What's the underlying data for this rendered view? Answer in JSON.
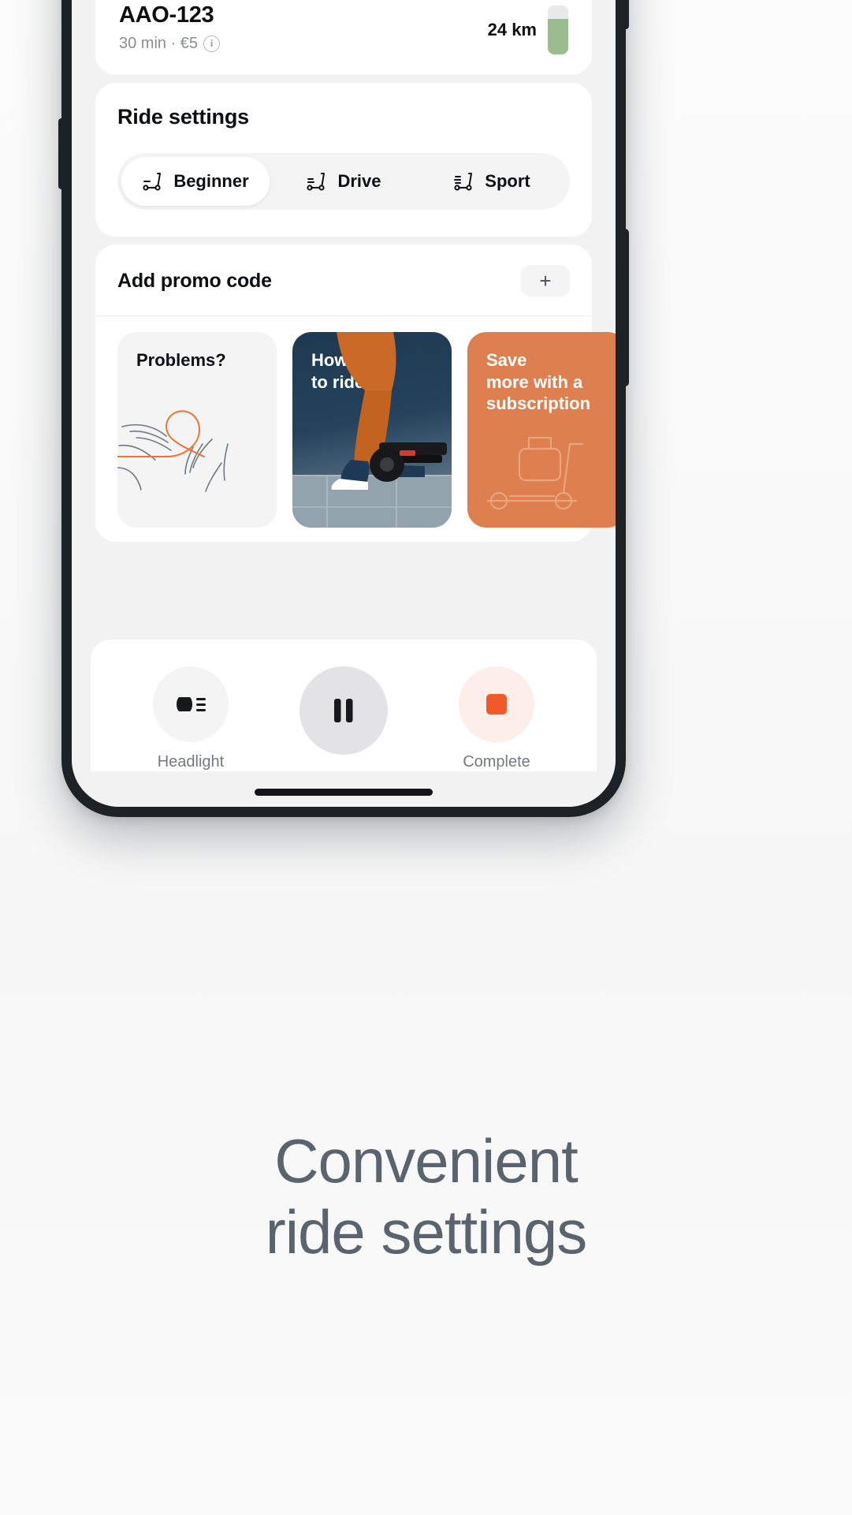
{
  "vehicle": {
    "id": "AAO-123",
    "pricing": "30 min · €5",
    "info_icon": "info-icon",
    "range": "24 km",
    "battery_icon": "battery-icon",
    "battery_level_pct": 72,
    "battery_color": "#9cbd8f"
  },
  "ride_settings": {
    "title": "Ride settings",
    "selected": "Beginner",
    "modes": [
      {
        "label": "Beginner",
        "icon": "scooter-icon",
        "active": true
      },
      {
        "label": "Drive",
        "icon": "scooter-icon",
        "active": false
      },
      {
        "label": "Sport",
        "icon": "scooter-icon",
        "active": false
      }
    ]
  },
  "promo": {
    "label": "Add promo code",
    "add_icon": "plus-icon",
    "add_label": "+"
  },
  "tiles": [
    {
      "title": "Problems?",
      "style": "light",
      "art": "hands-line-art"
    },
    {
      "title": "How\nto ride?",
      "title_line1": "How",
      "title_line2": "to ride?",
      "style": "photo",
      "art": "rider-photo"
    },
    {
      "title_line1": "Save",
      "title_line2": "more with a",
      "title_line3": "subscription",
      "style": "orange",
      "art": "scooter-outline",
      "color": "#dd7f4e"
    }
  ],
  "actions": [
    {
      "label": "Headlight",
      "icon": "headlight-icon",
      "variant": "light"
    },
    {
      "label": "",
      "icon": "pause-icon",
      "variant": "pause"
    },
    {
      "label": "Complete",
      "icon": "stop-icon",
      "variant": "stop",
      "color": "#ef5a28"
    }
  ],
  "marketing": {
    "line1": "Convenient",
    "line2_part1": "ride ",
    "line2_part2": "settings",
    "highlight_color": "#fcb525"
  },
  "system": {
    "home_indicator": "home-indicator"
  }
}
